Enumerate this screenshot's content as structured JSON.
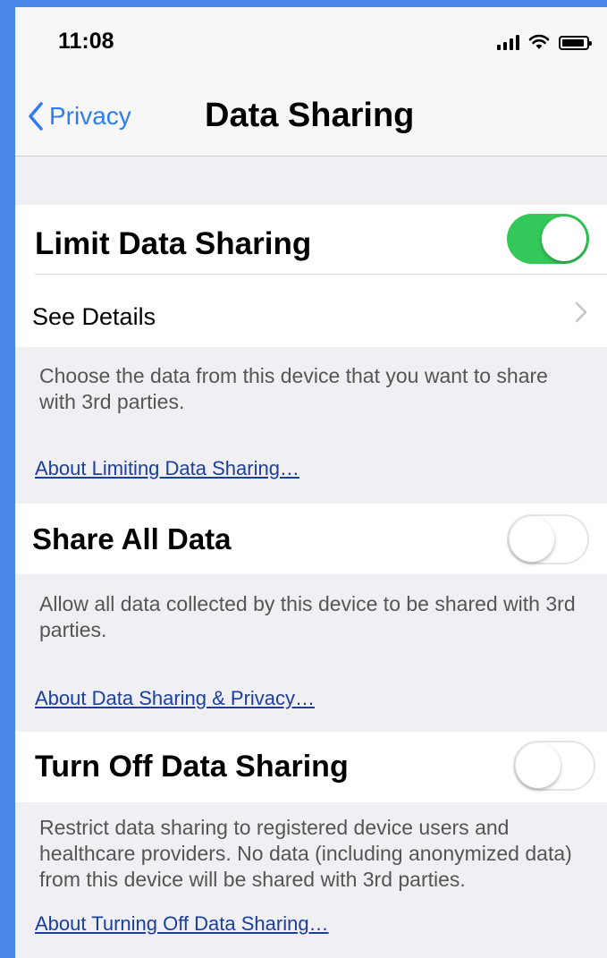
{
  "status_bar": {
    "time": "11:08"
  },
  "nav": {
    "back_label": "Privacy",
    "title": "Data Sharing"
  },
  "limit_section": {
    "title": "Limit Data Sharing",
    "toggle_on": true,
    "details_label": "See Details",
    "description": "Choose the data from this device that you want to share with 3rd parties.",
    "link": "About Limiting Data Sharing…"
  },
  "share_section": {
    "title": "Share All Data",
    "toggle_on": false,
    "description": "Allow all data collected by this device to be shared with 3rd parties.",
    "link": "About Data Sharing & Privacy…"
  },
  "off_section": {
    "title": "Turn Off Data Sharing",
    "toggle_on": false,
    "description": "Restrict data sharing to registered device users and healthcare providers. No data (including anonymized data) from this device will be shared with 3rd parties.",
    "link": "About Turning Off Data Sharing…"
  },
  "colors": {
    "accent": "#2e7cf6",
    "toggle_on": "#34c759",
    "link": "#1a3f9e",
    "frame": "#4a86e8"
  }
}
